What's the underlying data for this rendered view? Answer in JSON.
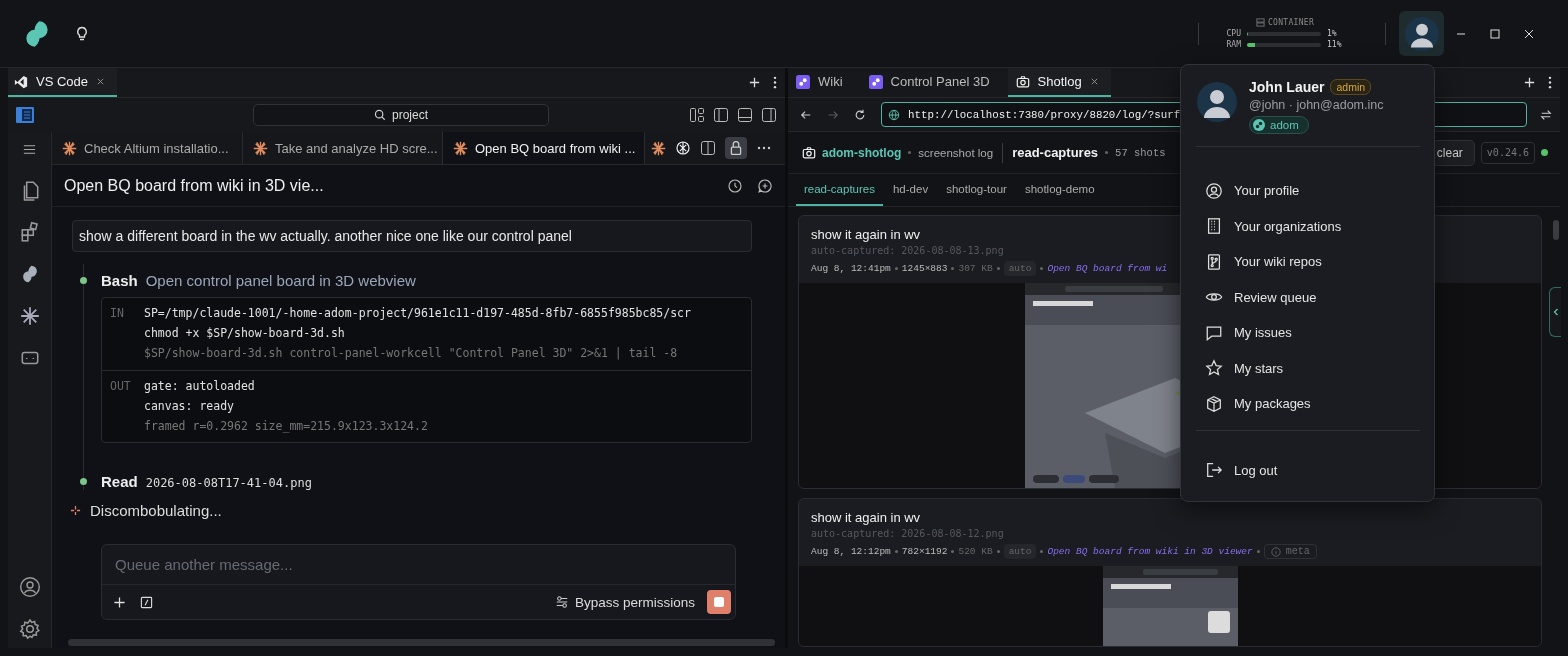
{
  "top_bar": {
    "container": {
      "title": "CONTAINER",
      "meters": [
        {
          "name": "CPU",
          "level": 0.01,
          "reading": "1%"
        },
        {
          "name": "RAM",
          "level": 0.11,
          "reading": "11%"
        }
      ]
    }
  },
  "left_pane": {
    "tabs": [
      {
        "label": "VS Code",
        "selected": true
      }
    ],
    "search": {
      "value": "project"
    },
    "editor_tabs": [
      {
        "label": "Check Altium installatio...",
        "selected": false
      },
      {
        "label": "Take and analyze HD scre...",
        "selected": false
      },
      {
        "label": "Open BQ board from wiki ...",
        "selected": true
      }
    ],
    "lock_on": true,
    "chat": {
      "title": "Open BQ board from wiki in 3D vie...",
      "user_message": "show a different board in the wv actually. another nice one like our control panel",
      "steps": [
        {
          "kind": "bash",
          "tool": "Bash",
          "summary": "Open control panel board in 3D webview",
          "input_label": "IN",
          "input": [
            "SP=/tmp/claude-1001/-home-adom-project/961e1c11-d197-485d-8fb7-6855f985bc85/scr",
            "chmod +x $SP/show-board-3d.sh",
            "$SP/show-board-3d.sh control-panel-workcell \"Control Panel 3D\" 2>&1 | tail -8"
          ],
          "output_label": "OUT",
          "output": [
            "gate: autoloaded",
            "canvas: ready",
            "framed r=0.2962 size_mm=215.9x123.3x124.2"
          ]
        },
        {
          "kind": "read",
          "tool": "Read",
          "file": "2026-08-08T17-41-04.png"
        }
      ],
      "status": "Discombobulating...",
      "composer": {
        "placeholder": "Queue another message...",
        "mode": "Bypass permissions"
      }
    }
  },
  "right_pane": {
    "tabs": [
      {
        "label": "Wiki",
        "kind": "page",
        "selected": false
      },
      {
        "label": "Control Panel 3D",
        "kind": "page",
        "selected": false
      },
      {
        "label": "Shotlog",
        "kind": "camera",
        "selected": true
      }
    ],
    "address": {
      "url": "http://localhost:7380/proxy/8820/log/?surf",
      "can_go_forward": false
    },
    "app": {
      "name": "adom-shotlog",
      "subtitle": "screenshot log",
      "log": "read-captures",
      "count": "57 shots",
      "clear": "clear",
      "version": "v0.24.6",
      "online": true,
      "tabs": [
        {
          "label": "read-captures",
          "selected": true
        },
        {
          "label": "hd-dev",
          "selected": false
        },
        {
          "label": "shotlog-tour",
          "selected": false
        },
        {
          "label": "shotlog-demo",
          "selected": false
        }
      ],
      "cards": [
        {
          "title": "show it again in wv",
          "file": "auto-captured: 2026-08-08-13.png",
          "time": "Aug 8, 12:41pm",
          "size": "1245×883",
          "bytes": "307 KB",
          "tag": "auto",
          "session": "Open BQ board from wi"
        },
        {
          "title": "show it again in wv",
          "file": "auto-captured: 2026-08-08-12.png",
          "time": "Aug 8, 12:12pm",
          "size": "782×1192",
          "bytes": "520 KB",
          "tag": "auto",
          "session": "Open BQ board from wiki in 3D viewer",
          "meta": "meta"
        }
      ]
    }
  },
  "user_menu": {
    "name": "John Lauer",
    "role": "admin",
    "handle": "@john · john@adom.inc",
    "org": "adom",
    "items": [
      "Your profile",
      "Your organizations",
      "Your wiki repos",
      "Review queue",
      "My issues",
      "My stars",
      "My packages"
    ],
    "logout": "Log out"
  }
}
